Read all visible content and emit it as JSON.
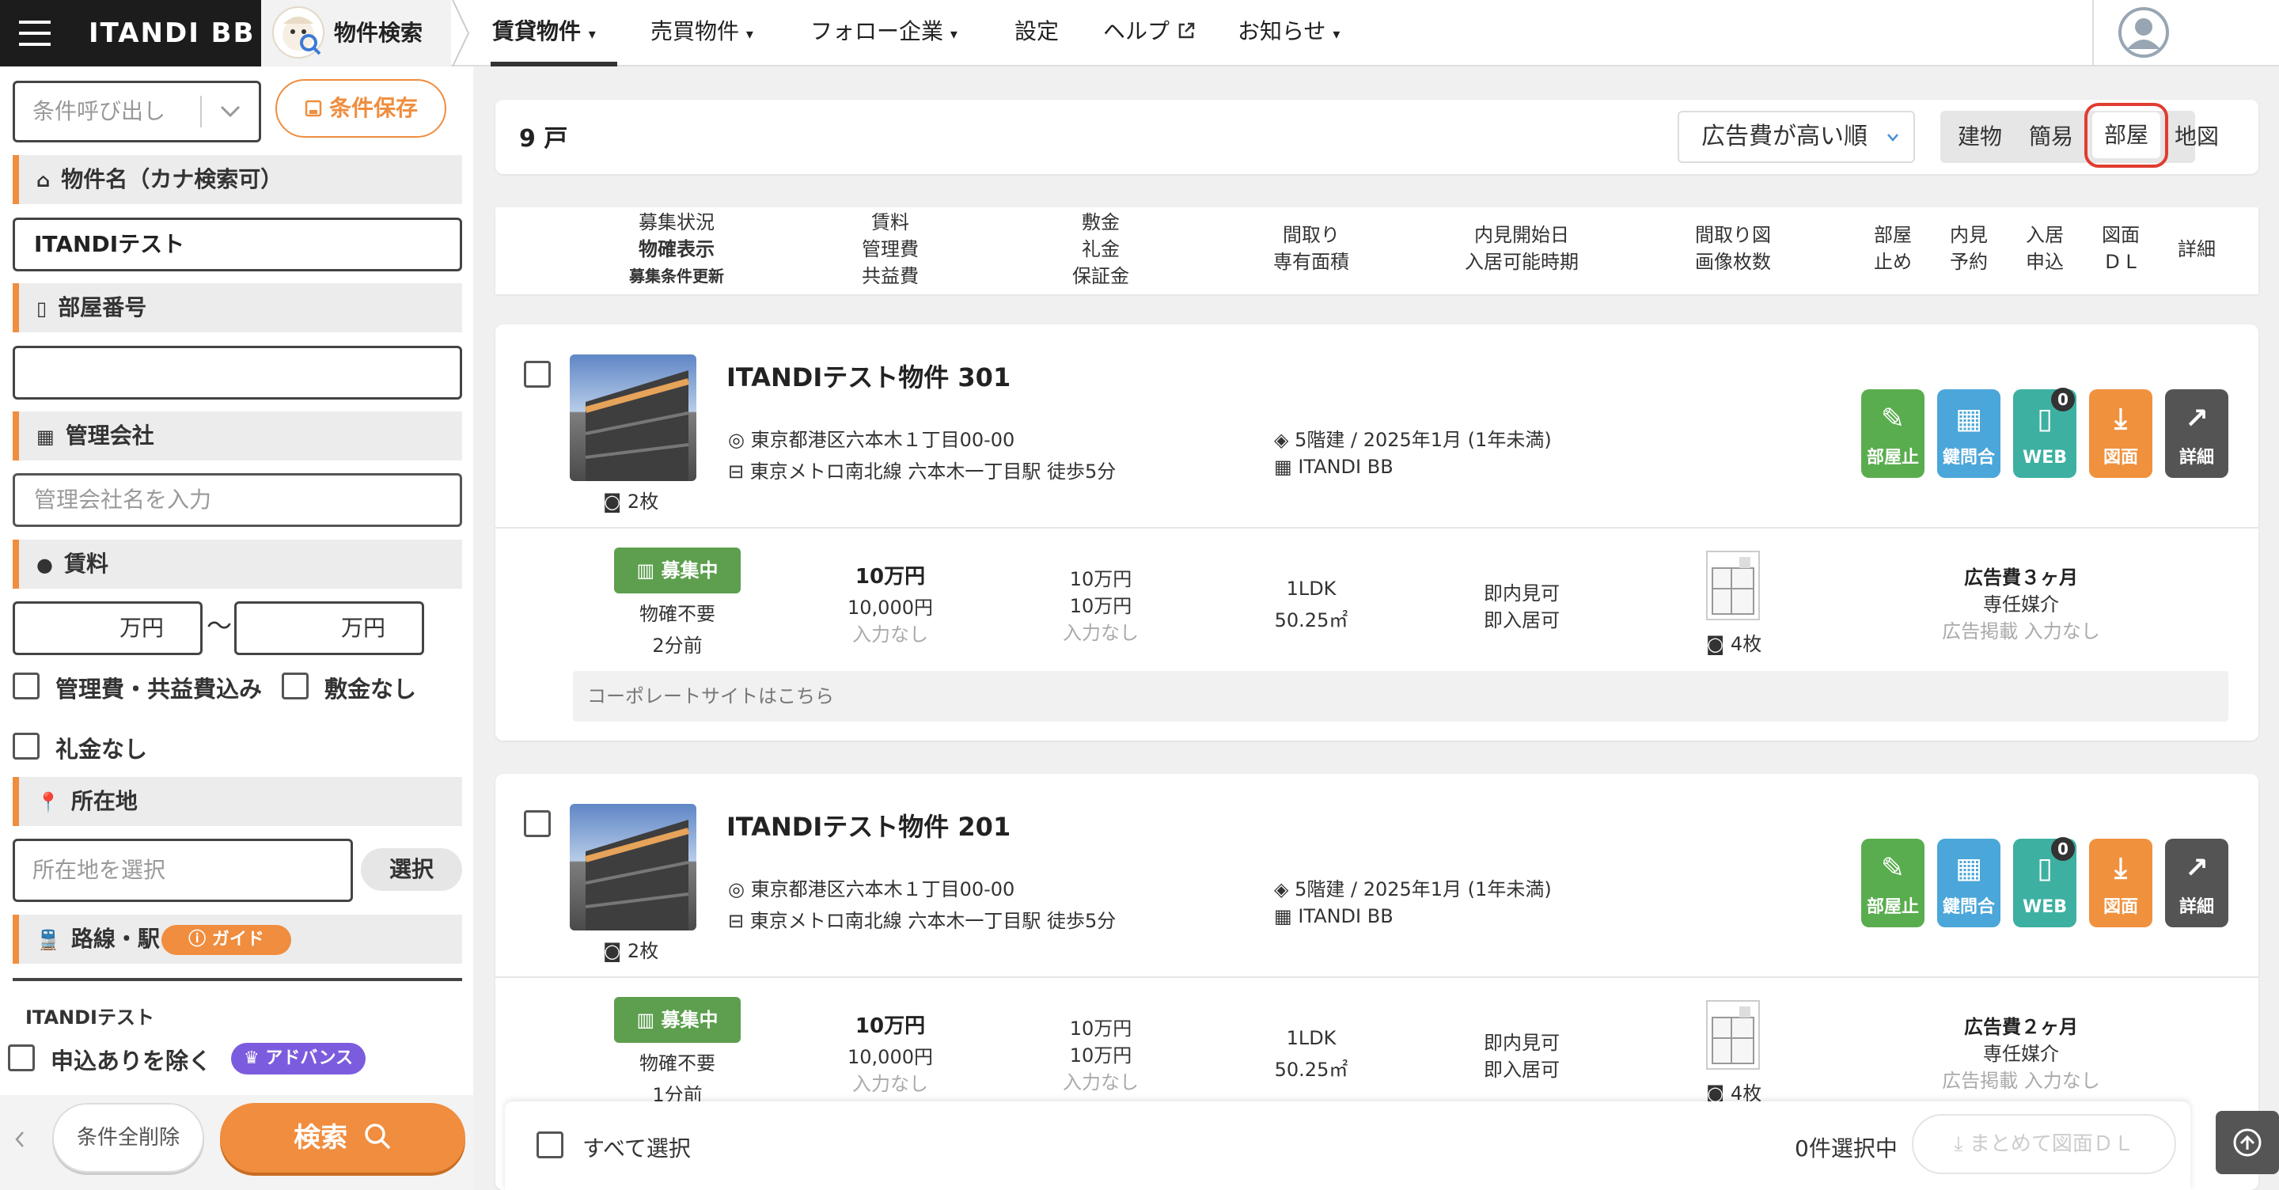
{
  "header": {
    "brand": "ITANDI BB",
    "app_name": "物件検索",
    "nav": [
      {
        "label": "賃貸物件",
        "caret": "▾"
      },
      {
        "label": "売買物件",
        "caret": "▾"
      },
      {
        "label": "フォロー企業",
        "caret": "▾"
      },
      {
        "label": "設定",
        "caret": ""
      },
      {
        "label": "ヘルプ",
        "caret": ""
      },
      {
        "label": "お知らせ",
        "caret": "▾"
      }
    ]
  },
  "sidebar": {
    "recall_placeholder": "条件呼び出し",
    "save_label": "条件保存",
    "name_section": "物件名（カナ検索可）",
    "name_value": "ITANDIテスト",
    "room_section": "部屋番号",
    "room_value": "",
    "company_section": "管理会社",
    "company_placeholder": "管理会社名を入力",
    "rent_section": "賃料",
    "rent_min_unit": "万円",
    "rent_sep": "〜",
    "rent_max_unit": "万円",
    "opt_fees": "管理費・共益費込み",
    "opt_no_deposit": "敷金なし",
    "opt_no_key_money": "礼金なし",
    "location_section": "所在地",
    "location_placeholder": "所在地を選択",
    "select_label": "選択",
    "line_section": "路線・駅",
    "guide_label": "ガイド",
    "itandi_test_label": "ITANDIテスト",
    "exclude_applied": "申込ありを除く",
    "advance_label": "アドバンス",
    "clear_all": "条件全削除",
    "search": "検索"
  },
  "results": {
    "count_label": "9 戸",
    "sort_label": "広告費が高い順",
    "views": [
      "建物",
      "簡易",
      "部屋",
      "地図"
    ],
    "selected_view": "部屋",
    "columns": [
      [
        "募集状況",
        "物確表示",
        "募集条件更新"
      ],
      [
        "賃料",
        "管理費",
        "共益費"
      ],
      [
        "敷金",
        "礼金",
        "保証金"
      ],
      [
        "間取り",
        "専有面積"
      ],
      [
        "内見開始日",
        "入居可能時期"
      ],
      [
        "間取り図",
        "画像枚数"
      ],
      [
        "部屋",
        "止め"
      ],
      [
        "内見",
        "予約"
      ],
      [
        "入居",
        "申込"
      ],
      [
        "図面",
        "D L"
      ],
      [
        "詳細"
      ]
    ]
  },
  "listings": [
    {
      "name": "ITANDIテスト物件 301",
      "address": "東京都港区六本木１丁目00-00",
      "station": "東京メトロ南北線 六本木一丁目駅 徒歩5分",
      "building": "5階建 / 2025年1月 (1年未満)",
      "company": "ITANDI BB",
      "photo_count": "2枚",
      "status": "募集中",
      "check": "物確不要",
      "updated": "2分前",
      "rent": "10万円",
      "mgmt_fee": "10,000円",
      "common_fee": "入力なし",
      "deposit": "10万円",
      "key_money": "10万円",
      "guarantee": "入力なし",
      "layout": "1LDK",
      "area": "50.25㎡",
      "viewing": "即内見可",
      "move_in": "即入居可",
      "image_count": "4枚",
      "ad_fee": "広告費３ヶ月",
      "agency": "専任媒介",
      "ad_listing": "広告掲載 入力なし",
      "corporate_link": "コーポレートサイトはこちら",
      "web_badge": "0"
    },
    {
      "name": "ITANDIテスト物件 201",
      "address": "東京都港区六本木１丁目00-00",
      "station": "東京メトロ南北線 六本木一丁目駅 徒歩5分",
      "building": "5階建 / 2025年1月 (1年未満)",
      "company": "ITANDI BB",
      "photo_count": "2枚",
      "status": "募集中",
      "check": "物確不要",
      "updated": "1分前",
      "rent": "10万円",
      "mgmt_fee": "10,000円",
      "common_fee": "入力なし",
      "deposit": "10万円",
      "key_money": "10万円",
      "guarantee": "入力なし",
      "layout": "1LDK",
      "area": "50.25㎡",
      "viewing": "即内見可",
      "move_in": "即入居可",
      "image_count": "4枚",
      "ad_fee": "広告費２ヶ月",
      "agency": "専任媒介",
      "ad_listing": "広告掲載 入力なし",
      "web_badge": "0"
    }
  ],
  "actions": [
    "部屋止",
    "鍵問合",
    "WEB",
    "図面",
    "詳細"
  ],
  "footer": {
    "select_all": "すべて選択",
    "selected_count": "0件選択中",
    "bulk_download": "まとめて図面ＤＬ"
  },
  "colors": {
    "accent": "#f08d3e",
    "green": "#5aad4e",
    "teal": "#3db0a1",
    "blue": "#4ba6d9",
    "orange": "#f0913e",
    "dark": "#545454",
    "purple": "#7c5cde",
    "view_highlight": "#e03c31"
  }
}
